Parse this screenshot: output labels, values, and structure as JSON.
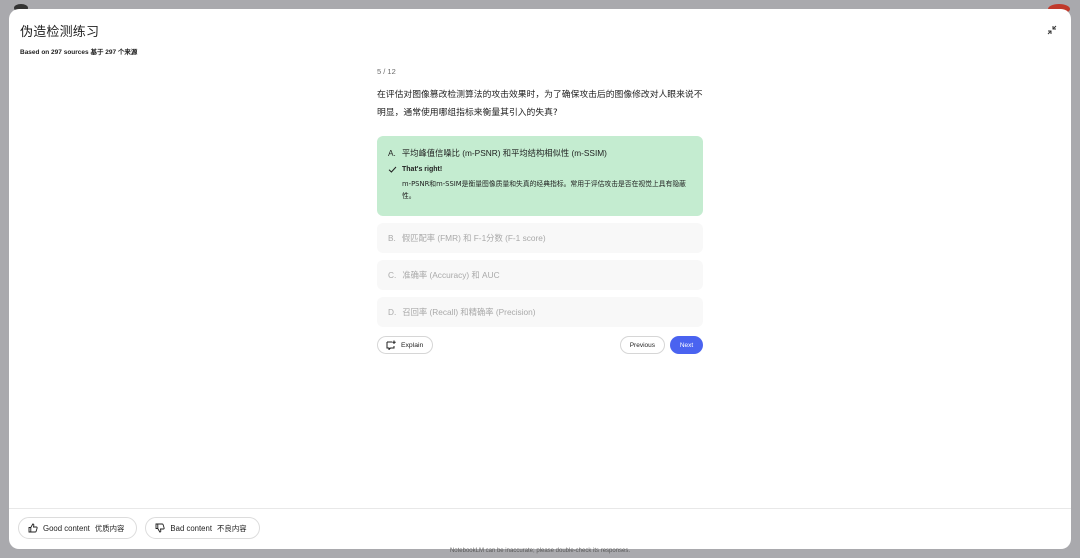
{
  "header": {
    "title": "伪造检测练习",
    "subtitle": "Based on 297 sources   基于 297 个来源"
  },
  "quiz": {
    "progress": "5 / 12",
    "question": "在评估对图像篡改检测算法的攻击效果时，为了确保攻击后的图像修改对人眼来说不明显，通常使用哪组指标来衡量其引入的失真?",
    "options": [
      {
        "letter": "A.",
        "text": "平均峰值信噪比 (m-PSNR) 和平均结构相似性 (m-SSIM)"
      },
      {
        "letter": "B.",
        "text": "假匹配率 (FMR) 和 F-1分数 (F-1 score)"
      },
      {
        "letter": "C.",
        "text": "准确率 (Accuracy) 和 AUC"
      },
      {
        "letter": "D.",
        "text": "召回率 (Recall) 和精确率 (Precision)"
      }
    ],
    "feedback": {
      "title": "That's right!",
      "text": "m-PSNR和m-SSIM是衡量图像质量和失真的经典指标。常用于评估攻击是否在视觉上具有隐蔽性。"
    }
  },
  "actions": {
    "explain_label": "Explain",
    "previous_label": "Previous",
    "next_label": "Next"
  },
  "footer": {
    "good_label": "Good content",
    "good_cn": "优质内容",
    "bad_label": "Bad content",
    "bad_cn": "不良内容",
    "disclaimer": "NotebookLM can be inaccurate; please double-check its responses."
  },
  "colors": {
    "accent": "#4a63f0",
    "correct_bg": "#c4ecd0",
    "option_bg": "#f8f8f8"
  }
}
